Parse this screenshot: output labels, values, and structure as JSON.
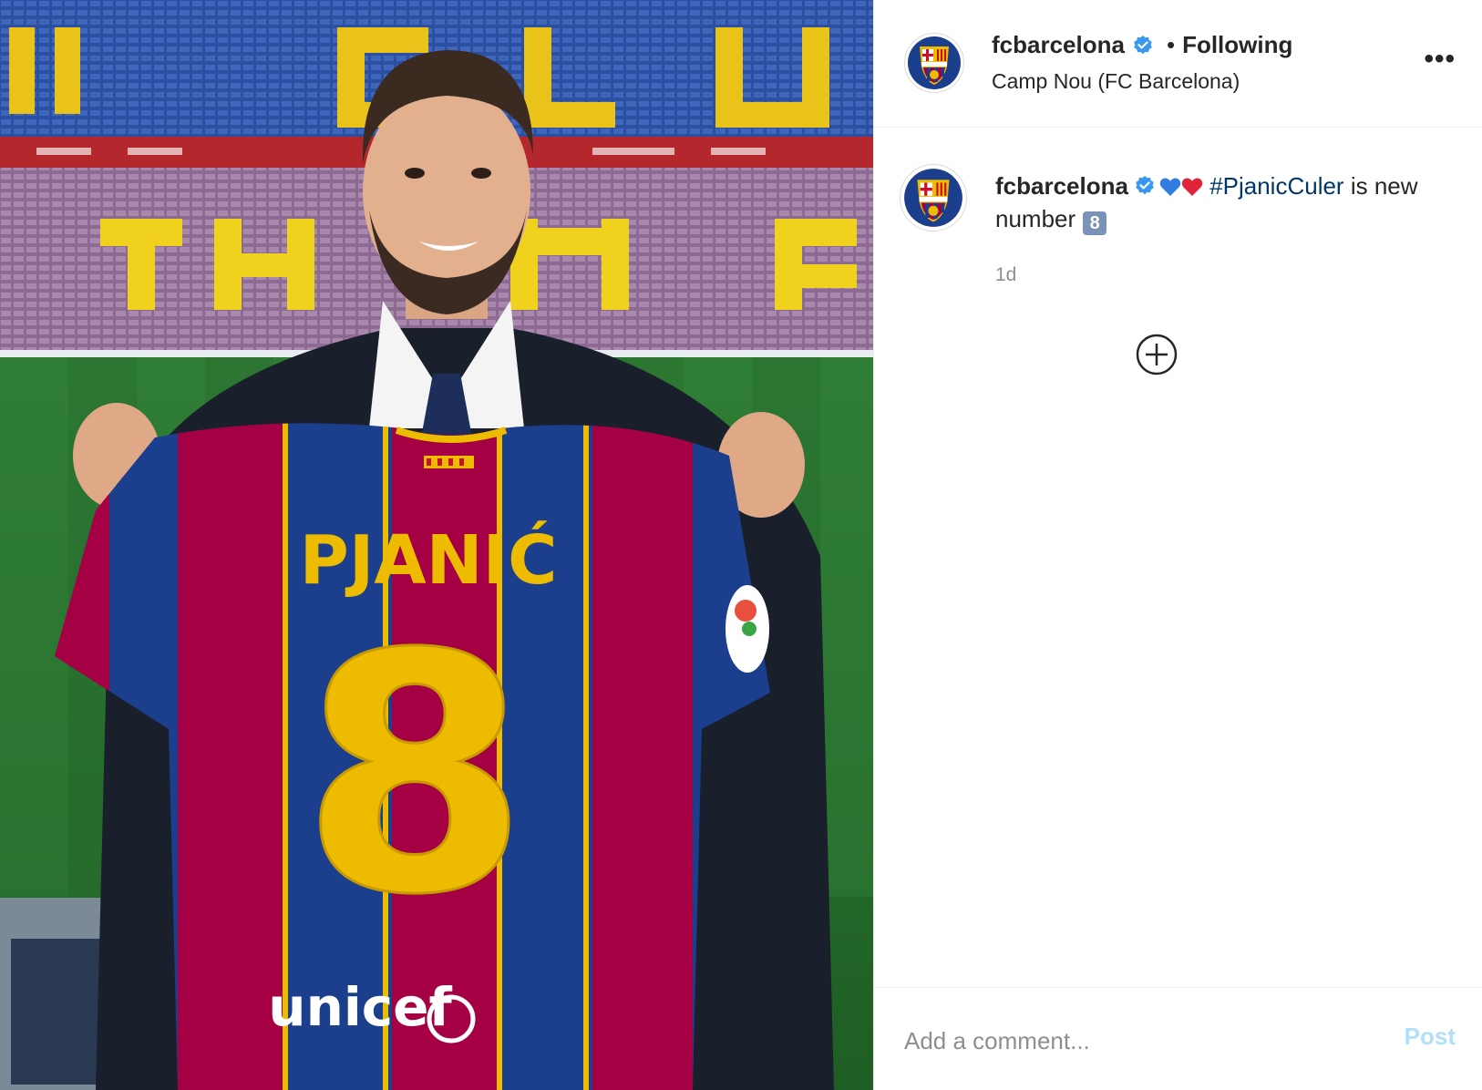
{
  "post": {
    "media": {
      "alt_icon": "photo",
      "jersey_name": "PJANIĆ",
      "jersey_number": "8",
      "sponsor": "unicef"
    },
    "header": {
      "username": "fcbarcelona",
      "separator": "•",
      "follow_status": "Following",
      "location": "Camp Nou (FC Barcelona)",
      "more_label": "•••"
    },
    "caption": {
      "username": "fcbarcelona",
      "hashtag": "#PjanicCuler",
      "text_after_hashtag": " is new number",
      "keycap": "8",
      "timestamp": "1d"
    },
    "comment": {
      "placeholder": "Add a comment...",
      "post_label": "Post"
    },
    "colors": {
      "verified_blue": "#3897f0",
      "hashtag_blue": "#00376b",
      "post_disabled": "#b2dffc",
      "barca_blue": "#1b3f8c",
      "barca_red": "#a50044",
      "barca_gold": "#edbb00"
    }
  }
}
